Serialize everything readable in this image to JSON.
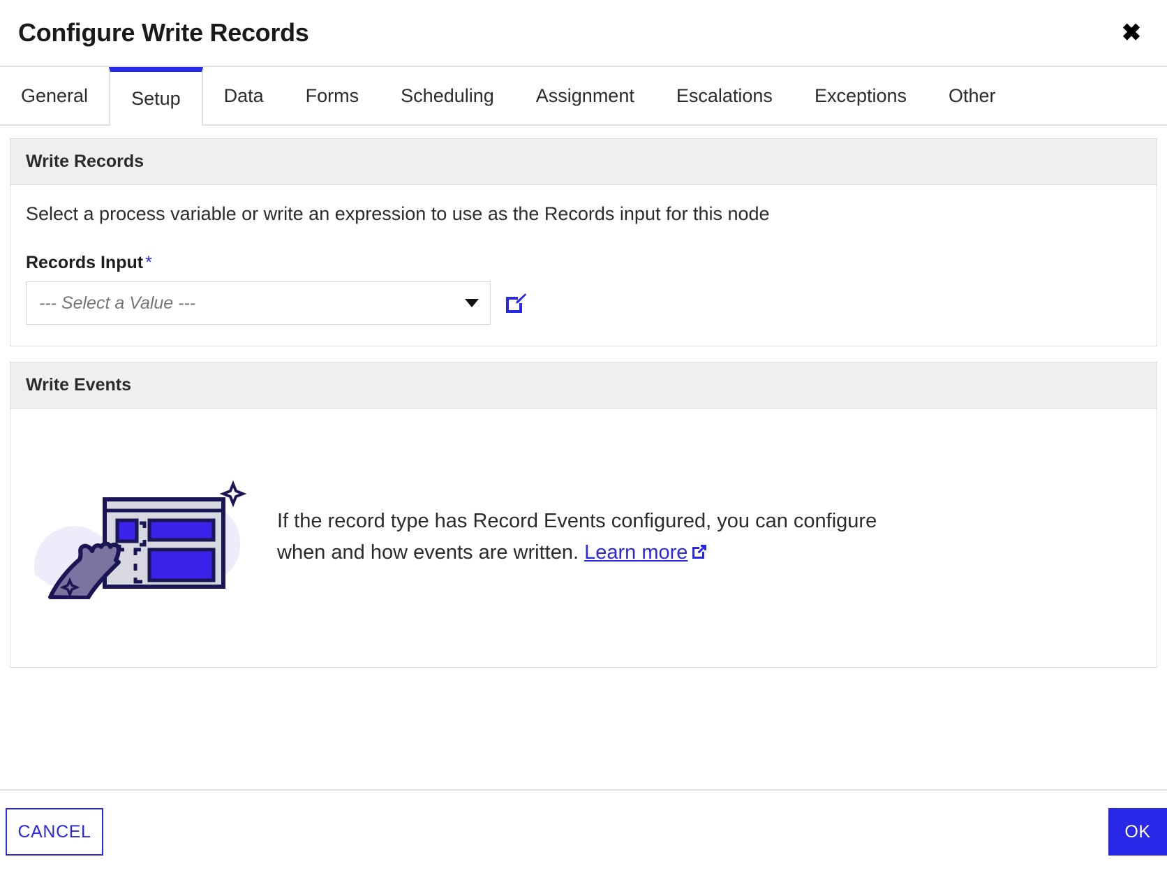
{
  "dialog": {
    "title": "Configure Write Records",
    "close_label": "✖"
  },
  "tabs": [
    {
      "label": "General",
      "active": false
    },
    {
      "label": "Setup",
      "active": true
    },
    {
      "label": "Data",
      "active": false
    },
    {
      "label": "Forms",
      "active": false
    },
    {
      "label": "Scheduling",
      "active": false
    },
    {
      "label": "Assignment",
      "active": false
    },
    {
      "label": "Escalations",
      "active": false
    },
    {
      "label": "Exceptions",
      "active": false
    },
    {
      "label": "Other",
      "active": false
    }
  ],
  "write_records": {
    "header": "Write Records",
    "description": "Select a process variable or write an expression to use as the Records input for this node",
    "field_label": "Records Input",
    "required_marker": "*",
    "select_value": "--- Select a Value ---",
    "edit_icon": "edit-expression-icon"
  },
  "write_events": {
    "header": "Write Events",
    "text_before_link": "If the record type has Record Events configured, you can configure when and how events are written. ",
    "link_label": "Learn more",
    "external_icon": "external-link-icon",
    "illustration": "hand-pointing-at-browser-window-illustration"
  },
  "footer": {
    "cancel_label": "CANCEL",
    "ok_label": "OK"
  },
  "colors": {
    "accent": "#2927e8",
    "panel_header_bg": "#efefef",
    "border": "#dcdcdc",
    "illus_dark": "#1c1555",
    "illus_blue": "#3923e8",
    "illus_gray": "#d8d8e0",
    "illus_blob": "#eeebfa",
    "illus_hand": "#7b74a0"
  }
}
